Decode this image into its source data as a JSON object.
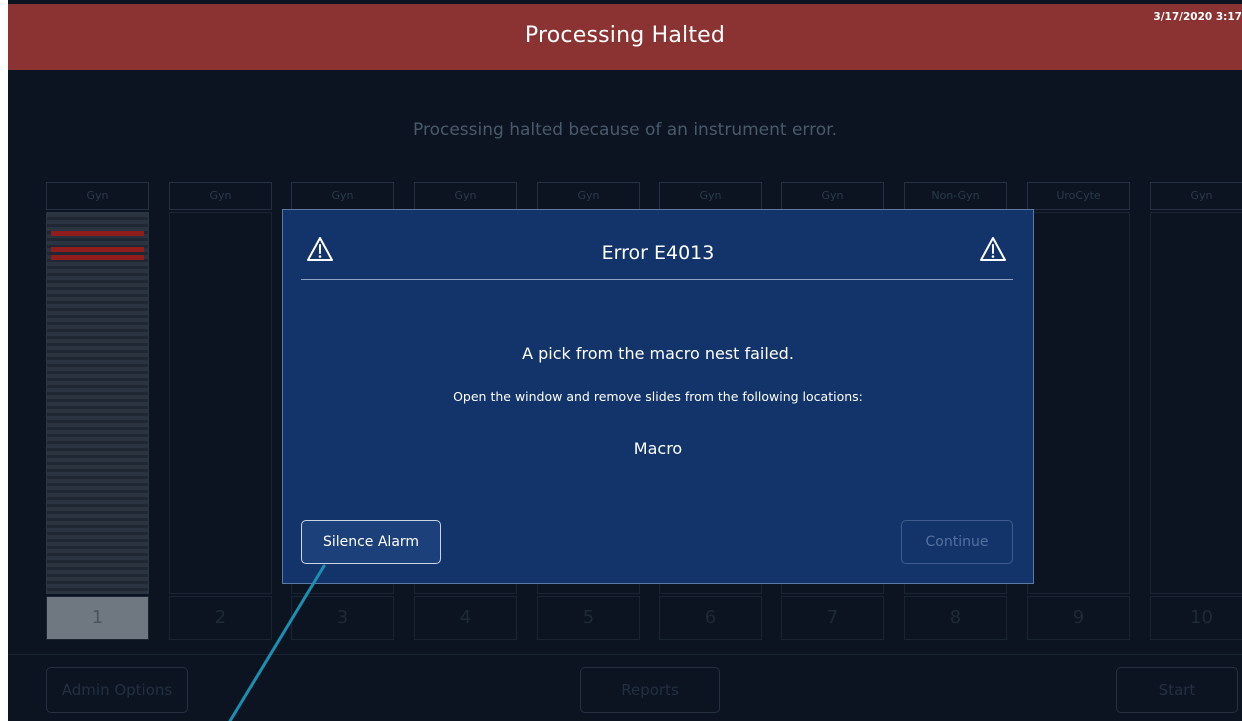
{
  "header": {
    "title": "Processing Halted",
    "timestamp": "3/17/2020 3:17"
  },
  "halt_message": "Processing halted because of an instrument error.",
  "racks": [
    {
      "label": "Gyn",
      "number": "1",
      "active": true
    },
    {
      "label": "Gyn",
      "number": "2"
    },
    {
      "label": "Gyn",
      "number": "3"
    },
    {
      "label": "Gyn",
      "number": "4"
    },
    {
      "label": "Gyn",
      "number": "5"
    },
    {
      "label": "Gyn",
      "number": "6"
    },
    {
      "label": "Gyn",
      "number": "7"
    },
    {
      "label": "Non-Gyn",
      "number": "8"
    },
    {
      "label": "UroCyte",
      "number": "9"
    },
    {
      "label": "Gyn",
      "number": "10"
    }
  ],
  "bottom_bar": {
    "admin_label": "Admin Options",
    "reports_label": "Reports",
    "start_label": "Start"
  },
  "modal": {
    "title": "Error E4013",
    "message": "A pick from the macro nest failed.",
    "instruction": "Open the window and remove slides from the following locations:",
    "location": "Macro",
    "silence_label": "Silence Alarm",
    "continue_label": "Continue"
  },
  "colors": {
    "header_bg": "#8b3333",
    "modal_bg": "#13346b",
    "app_bg": "#0b1420",
    "annotation_line": "#1a8fb0"
  },
  "icons": [
    "warning-icon"
  ]
}
